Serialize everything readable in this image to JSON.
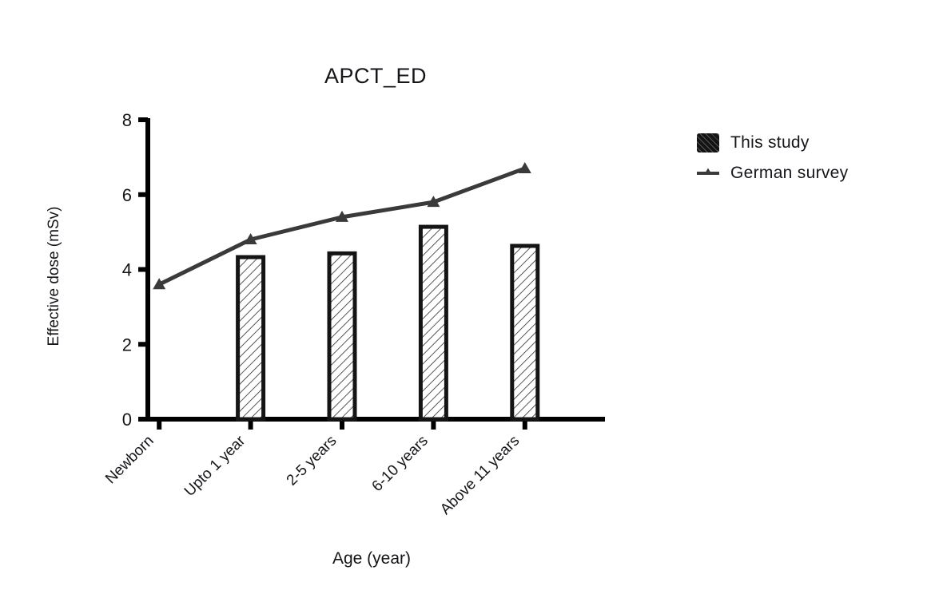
{
  "chart_data": {
    "type": "bar",
    "title": "APCT_ED",
    "xlabel": "Age (year)",
    "ylabel": "Effective dose (mSv)",
    "categories": [
      "Newborn",
      "Upto 1 year",
      "2-5 years",
      "6-10 years",
      "Above 11 years"
    ],
    "ylim": [
      0,
      8
    ],
    "yticks": [
      0,
      2,
      4,
      6,
      8
    ],
    "ytick_labels": [
      "0",
      "2",
      "4",
      "6",
      "8"
    ],
    "grid": false,
    "legend_position": "right",
    "series": [
      {
        "name": "This study",
        "type": "bar",
        "style": "hatched",
        "color": "#141414",
        "values": [
          null,
          4.33,
          4.43,
          5.14,
          4.63
        ]
      },
      {
        "name": "German survey",
        "type": "line",
        "marker": "triangle",
        "color": "#3a3a3a",
        "values": [
          3.6,
          4.8,
          5.4,
          5.8,
          6.7
        ]
      }
    ]
  },
  "legend": {
    "items": [
      {
        "label": "This study",
        "marker": "bar-swatch"
      },
      {
        "label": "German survey",
        "marker": "line-triangle"
      }
    ]
  },
  "colors": {
    "axis": "#000000",
    "bar_edge": "#141414",
    "bar_fill": "#ffffff",
    "line": "#3a3a3a",
    "text": "#15161a"
  }
}
